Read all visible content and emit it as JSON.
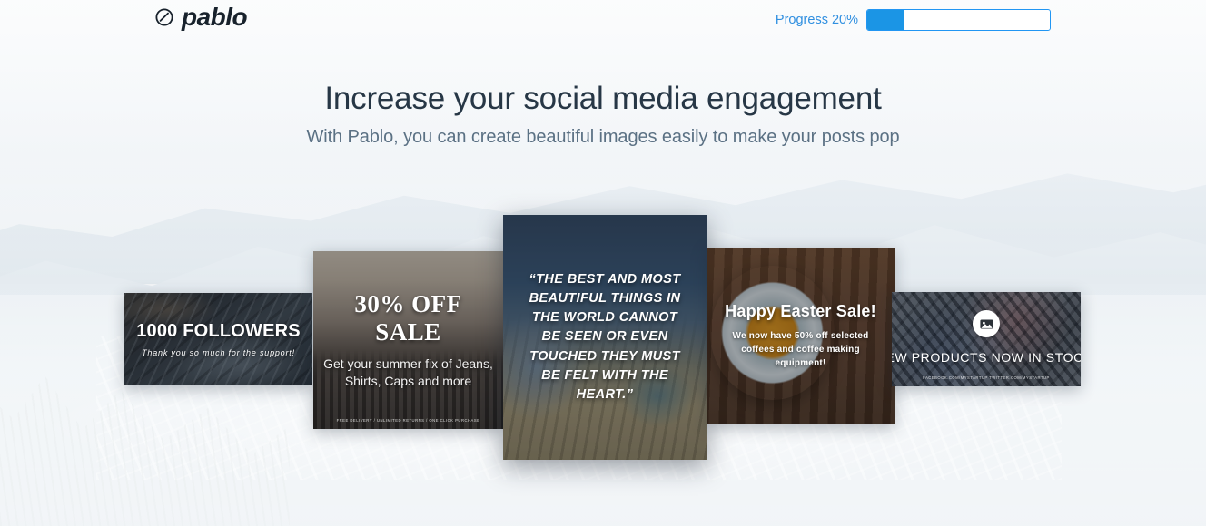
{
  "header": {
    "logo_text": "pablo",
    "logo_icon": "pablo-circle-slash-icon",
    "progress_label": "Progress 20%",
    "progress_value": 20,
    "progress_color": "#1b95e5",
    "progress_border_color": "#2196f3",
    "progress_label_color": "#2f8fe0"
  },
  "hero": {
    "headline": "Increase your social media engagement",
    "subhead": "With Pablo, you can create beautiful images easily to make your posts pop",
    "headline_color": "#273746",
    "subhead_color": "#5b7184"
  },
  "carousel": {
    "cards": [
      {
        "id": "followers",
        "title": "1000 FOLLOWERS",
        "subtitle": "Thank you so much for the support!",
        "footer": "",
        "scene": "coastal cliffs and ocean"
      },
      {
        "id": "sale",
        "title": "30% OFF SALE",
        "subtitle": "Get your summer fix of Jeans, Shirts, Caps and more",
        "footer": "FREE DELIVERY / UNLIMITED RETURNS / ONE CLICK PURCHASE",
        "scene": "clothing store rail"
      },
      {
        "id": "quote",
        "title": "“THE BEST AND MOST BEAUTIFUL THINGS IN THE WORLD CANNOT BE SEEN OR EVEN TOUCHED THEY MUST BE FELT WITH THE HEART.”",
        "subtitle": "",
        "footer": "",
        "scene": "hiker looking over the coast"
      },
      {
        "id": "easter",
        "title": "Happy Easter Sale!",
        "subtitle": "We now have 50% off selected coffees and coffee making equipment!",
        "footer": "",
        "scene": "coffee cup on wooden table"
      },
      {
        "id": "products",
        "title": "NEW PRODUCTS NOW IN STOCK!",
        "subtitle": "",
        "footer": "FACEBOOK.COM/MYSTARTUP     TWITTER.COM/MYSTARTUP",
        "badge_icon": "image-photo-icon",
        "scene": "crowd on stairs"
      }
    ]
  }
}
